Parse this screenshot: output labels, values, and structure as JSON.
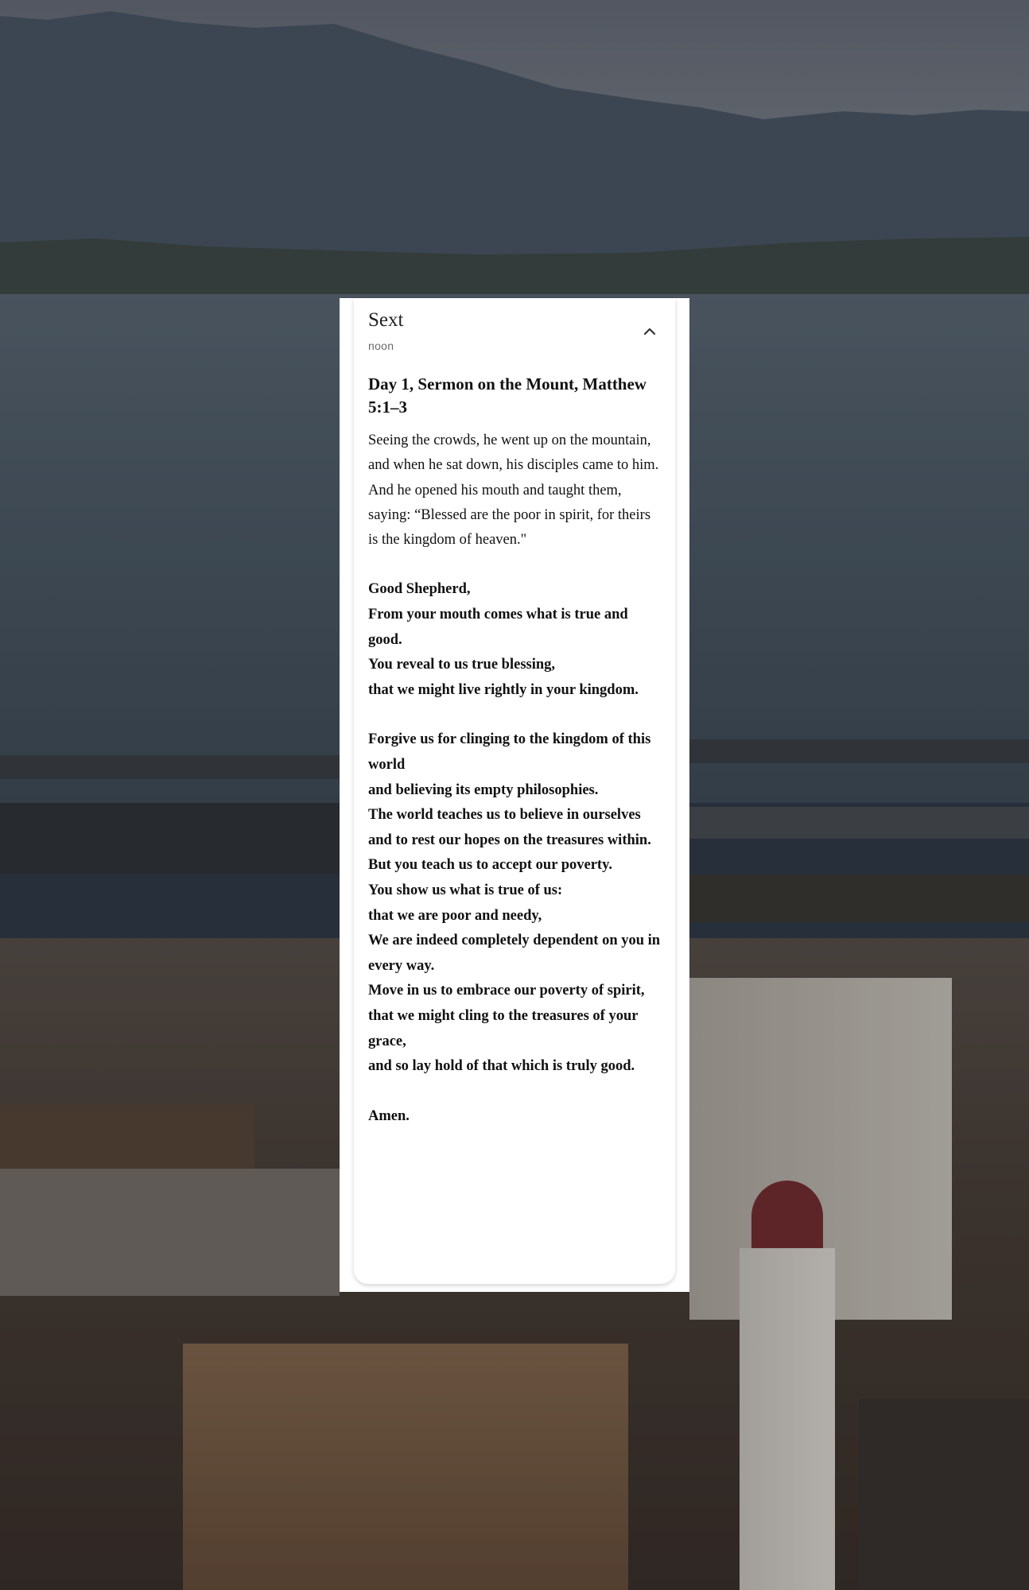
{
  "card": {
    "title": "Sext",
    "subtitle": "noon",
    "collapse_icon": "chevron-up-icon"
  },
  "reading": {
    "heading": "Day 1, Sermon on the Mount, Matthew 5:1–3",
    "passage": "Seeing the crowds, he went up on the mountain, and when he sat down, his disciples came to him. And he opened his mouth and taught them, saying: “Blessed are the poor in spirit, for theirs is the kingdom of heaven.\""
  },
  "prayer": {
    "stanza1": [
      "Good Shepherd,",
      "From your mouth comes what is true and good.",
      "You reveal to us true blessing,",
      "that we might live rightly in your kingdom."
    ],
    "stanza2": [
      "Forgive us for clinging to the kingdom of this world",
      "and believing its empty philosophies.",
      "The world teaches us to believe in ourselves",
      "and to rest our hopes on the treasures within.",
      "But you teach us to accept our poverty.",
      "You show us what is true of us:",
      "that we are poor and needy,",
      "We are indeed completely dependent on you in every way.",
      "Move in us to embrace our poverty of spirit,",
      "that we might cling to the treasures of your grace,",
      "and so lay hold of that which is truly good."
    ],
    "closing": "Amen."
  }
}
